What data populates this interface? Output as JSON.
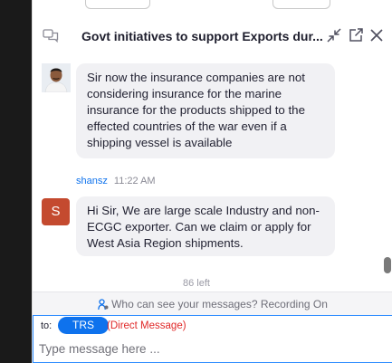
{
  "header": {
    "title": "Govt initiatives to support Exports dur..."
  },
  "messages": [
    {
      "text": "Sir now the insurance companies are not considering insurance for the marine insurance for the products shipped to the effected countries of the war even if a shipping vessel is available"
    },
    {
      "sender": "shansz",
      "time": "11:22 AM",
      "avatar_letter": "S",
      "text": "Hi Sir, We are large scale Industry and non-ECGC exporter. Can we claim or apply for West Asia Region shipments."
    }
  ],
  "partial_text": "86 left",
  "privacy": {
    "text": "Who can see your messages? Recording On"
  },
  "compose": {
    "to_label": "to:",
    "recipient": "TRS",
    "dm_label": "(Direct Message)",
    "placeholder": "Type message here ..."
  },
  "colors": {
    "accent": "#0e72ed",
    "direct_message": "#e02828",
    "avatar_s": "#c44a2f",
    "bubble": "#f1f1f4"
  },
  "icons": [
    "chat-icon",
    "collapse-icon",
    "popout-icon",
    "close-icon",
    "privacy-icon"
  ]
}
